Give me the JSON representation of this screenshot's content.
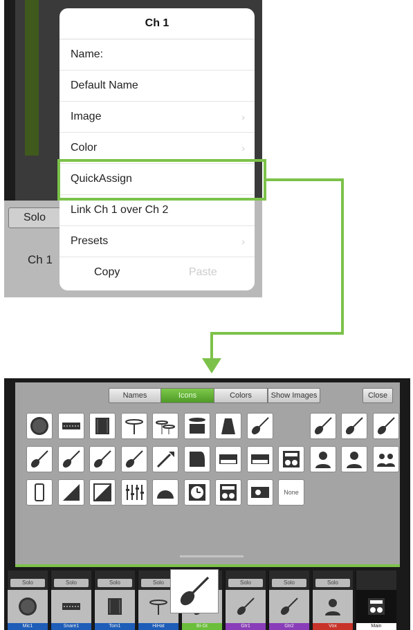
{
  "top_panel": {
    "solo_label": "Solo",
    "channel_label": "Ch 1",
    "popup_title": "Ch 1",
    "menu_items": [
      "Name:",
      "Default Name",
      "Image",
      "Color",
      "QuickAssign",
      "Link Ch 1 over Ch 2",
      "Presets"
    ],
    "copy_label": "Copy",
    "paste_label": "Paste"
  },
  "icon_panel": {
    "tabs": [
      "Names",
      "Icons",
      "Colors",
      "Show Images"
    ],
    "active_tab": "Icons",
    "close_label": "Close",
    "none_label": "None",
    "icons_row1": [
      "kick-drum",
      "snare-drum",
      "floor-tom",
      "hihat",
      "cymbals",
      "drum-kit",
      "cowbell",
      "electric-guitar",
      "blank",
      "electric-guitar-2",
      "electric-guitar-3",
      "flying-v-guitar"
    ],
    "icons_row2": [
      "acoustic-guitar",
      "acoustic-guitar-2",
      "violin",
      "mandolin",
      "trumpet",
      "piano",
      "synth",
      "keyboard",
      "amp",
      "female-vocal",
      "male-vocal",
      "group-vocal"
    ],
    "icons_row3": [
      "phone",
      "wedge",
      "di-box",
      "mixer",
      "in-ear",
      "clock",
      "speaker-stack",
      "media-player",
      "none"
    ]
  },
  "channel_strip": {
    "solo_label": "Solo",
    "channels": [
      {
        "name": "Mic1",
        "icon": "kick-drum",
        "color": "#1e5db8"
      },
      {
        "name": "Snare1",
        "icon": "snare-drum",
        "color": "#1e5db8"
      },
      {
        "name": "Tom1",
        "icon": "floor-tom",
        "color": "#1e5db8"
      },
      {
        "name": "HiHat",
        "icon": "hihat",
        "color": "#1e5db8"
      },
      {
        "name": "Bi-Gt",
        "icon": "electric-guitar",
        "color": "#6bbf3a"
      },
      {
        "name": "Gtr1",
        "icon": "acoustic-guitar",
        "color": "#8a3db8"
      },
      {
        "name": "Gtr2",
        "icon": "acoustic-guitar",
        "color": "#8a3db8"
      },
      {
        "name": "Vox",
        "icon": "male-vocal",
        "color": "#c8332a"
      },
      {
        "name": "Main",
        "icon": "speaker-stack",
        "color": "#ffffff"
      }
    ]
  },
  "colors": {
    "highlight": "#7cc24a"
  }
}
